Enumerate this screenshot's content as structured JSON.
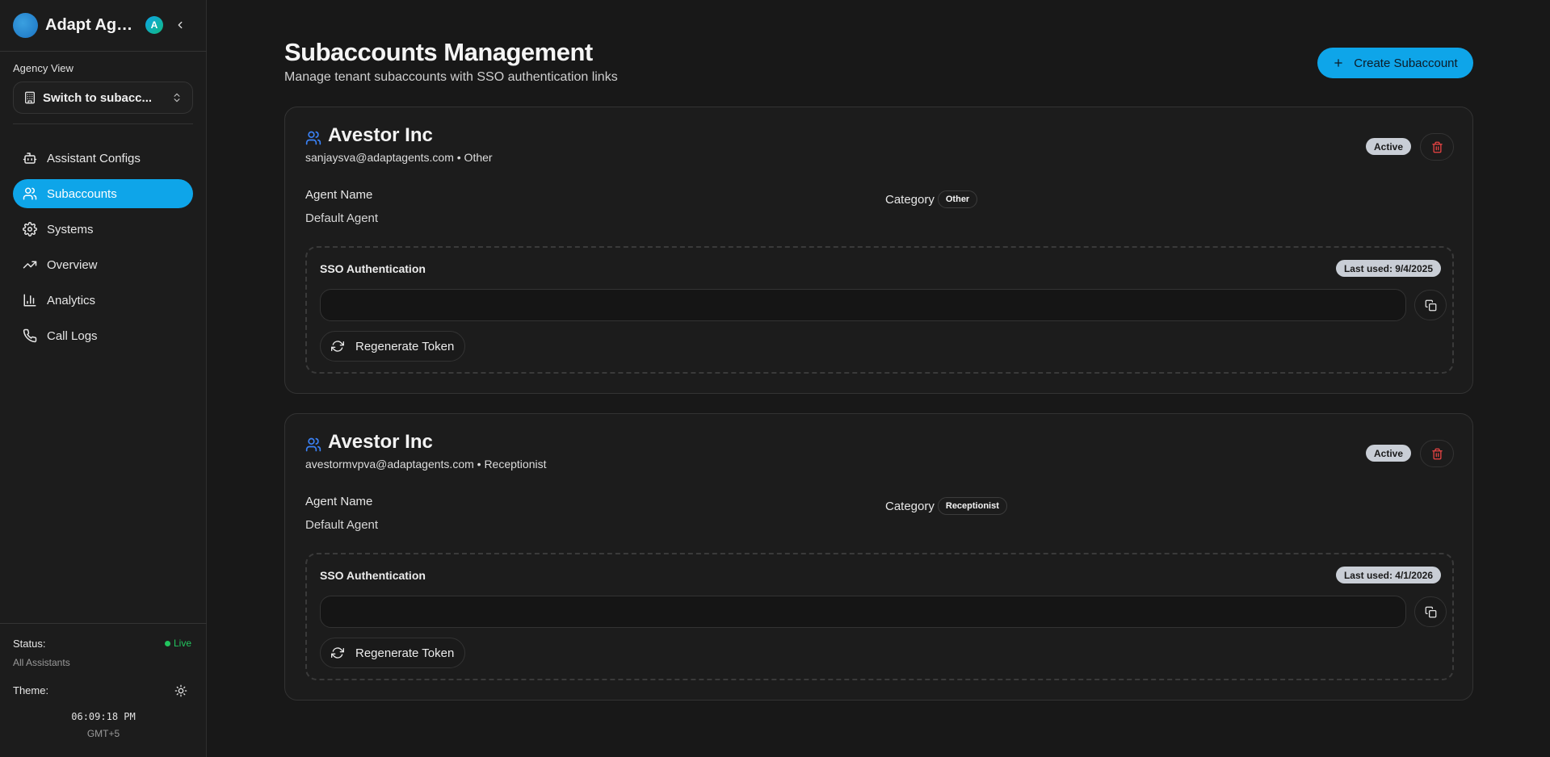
{
  "sidebar": {
    "brand_name": "Adapt Agents",
    "avatar_initial": "A",
    "agency_label": "Agency View",
    "switcher_label": "Switch to subacc...",
    "items": [
      {
        "label": "Assistant Configs",
        "icon": "bot-icon",
        "active": false
      },
      {
        "label": "Subaccounts",
        "icon": "users-icon",
        "active": true
      },
      {
        "label": "Systems",
        "icon": "gear-icon",
        "active": false
      },
      {
        "label": "Overview",
        "icon": "trending-up-icon",
        "active": false
      },
      {
        "label": "Analytics",
        "icon": "bar-chart-icon",
        "active": false
      },
      {
        "label": "Call Logs",
        "icon": "phone-icon",
        "active": false
      }
    ],
    "status_label": "Status:",
    "status_value": "Live",
    "assistants_label": "All Assistants",
    "theme_label": "Theme:",
    "clock": "06:09:18 PM",
    "timezone": "GMT+5"
  },
  "header": {
    "title": "Subaccounts Management",
    "subtitle": "Manage tenant subaccounts with SSO authentication links",
    "create_label": "Create Subaccount"
  },
  "subaccounts": [
    {
      "name": "Avestor Inc",
      "meta": "sanjaysva@adaptagents.com • Other",
      "status": "Active",
      "agent_label": "Agent Name",
      "agent_value": "Default Agent",
      "category_label": "Category",
      "category_value": "Other",
      "sso_title": "SSO Authentication",
      "last_used": "Last used: 9/4/2025",
      "token_value": "",
      "regen_label": "Regenerate Token"
    },
    {
      "name": "Avestor Inc",
      "meta": "avestormvpva@adaptagents.com • Receptionist",
      "status": "Active",
      "agent_label": "Agent Name",
      "agent_value": "Default Agent",
      "category_label": "Category",
      "category_value": "Receptionist",
      "sso_title": "SSO Authentication",
      "last_used": "Last used: 4/1/2026",
      "token_value": "",
      "regen_label": "Regenerate Token"
    }
  ],
  "colors": {
    "accent": "#0ea5e9",
    "danger": "#ef4444",
    "live": "#22c55e",
    "background": "#181818"
  }
}
